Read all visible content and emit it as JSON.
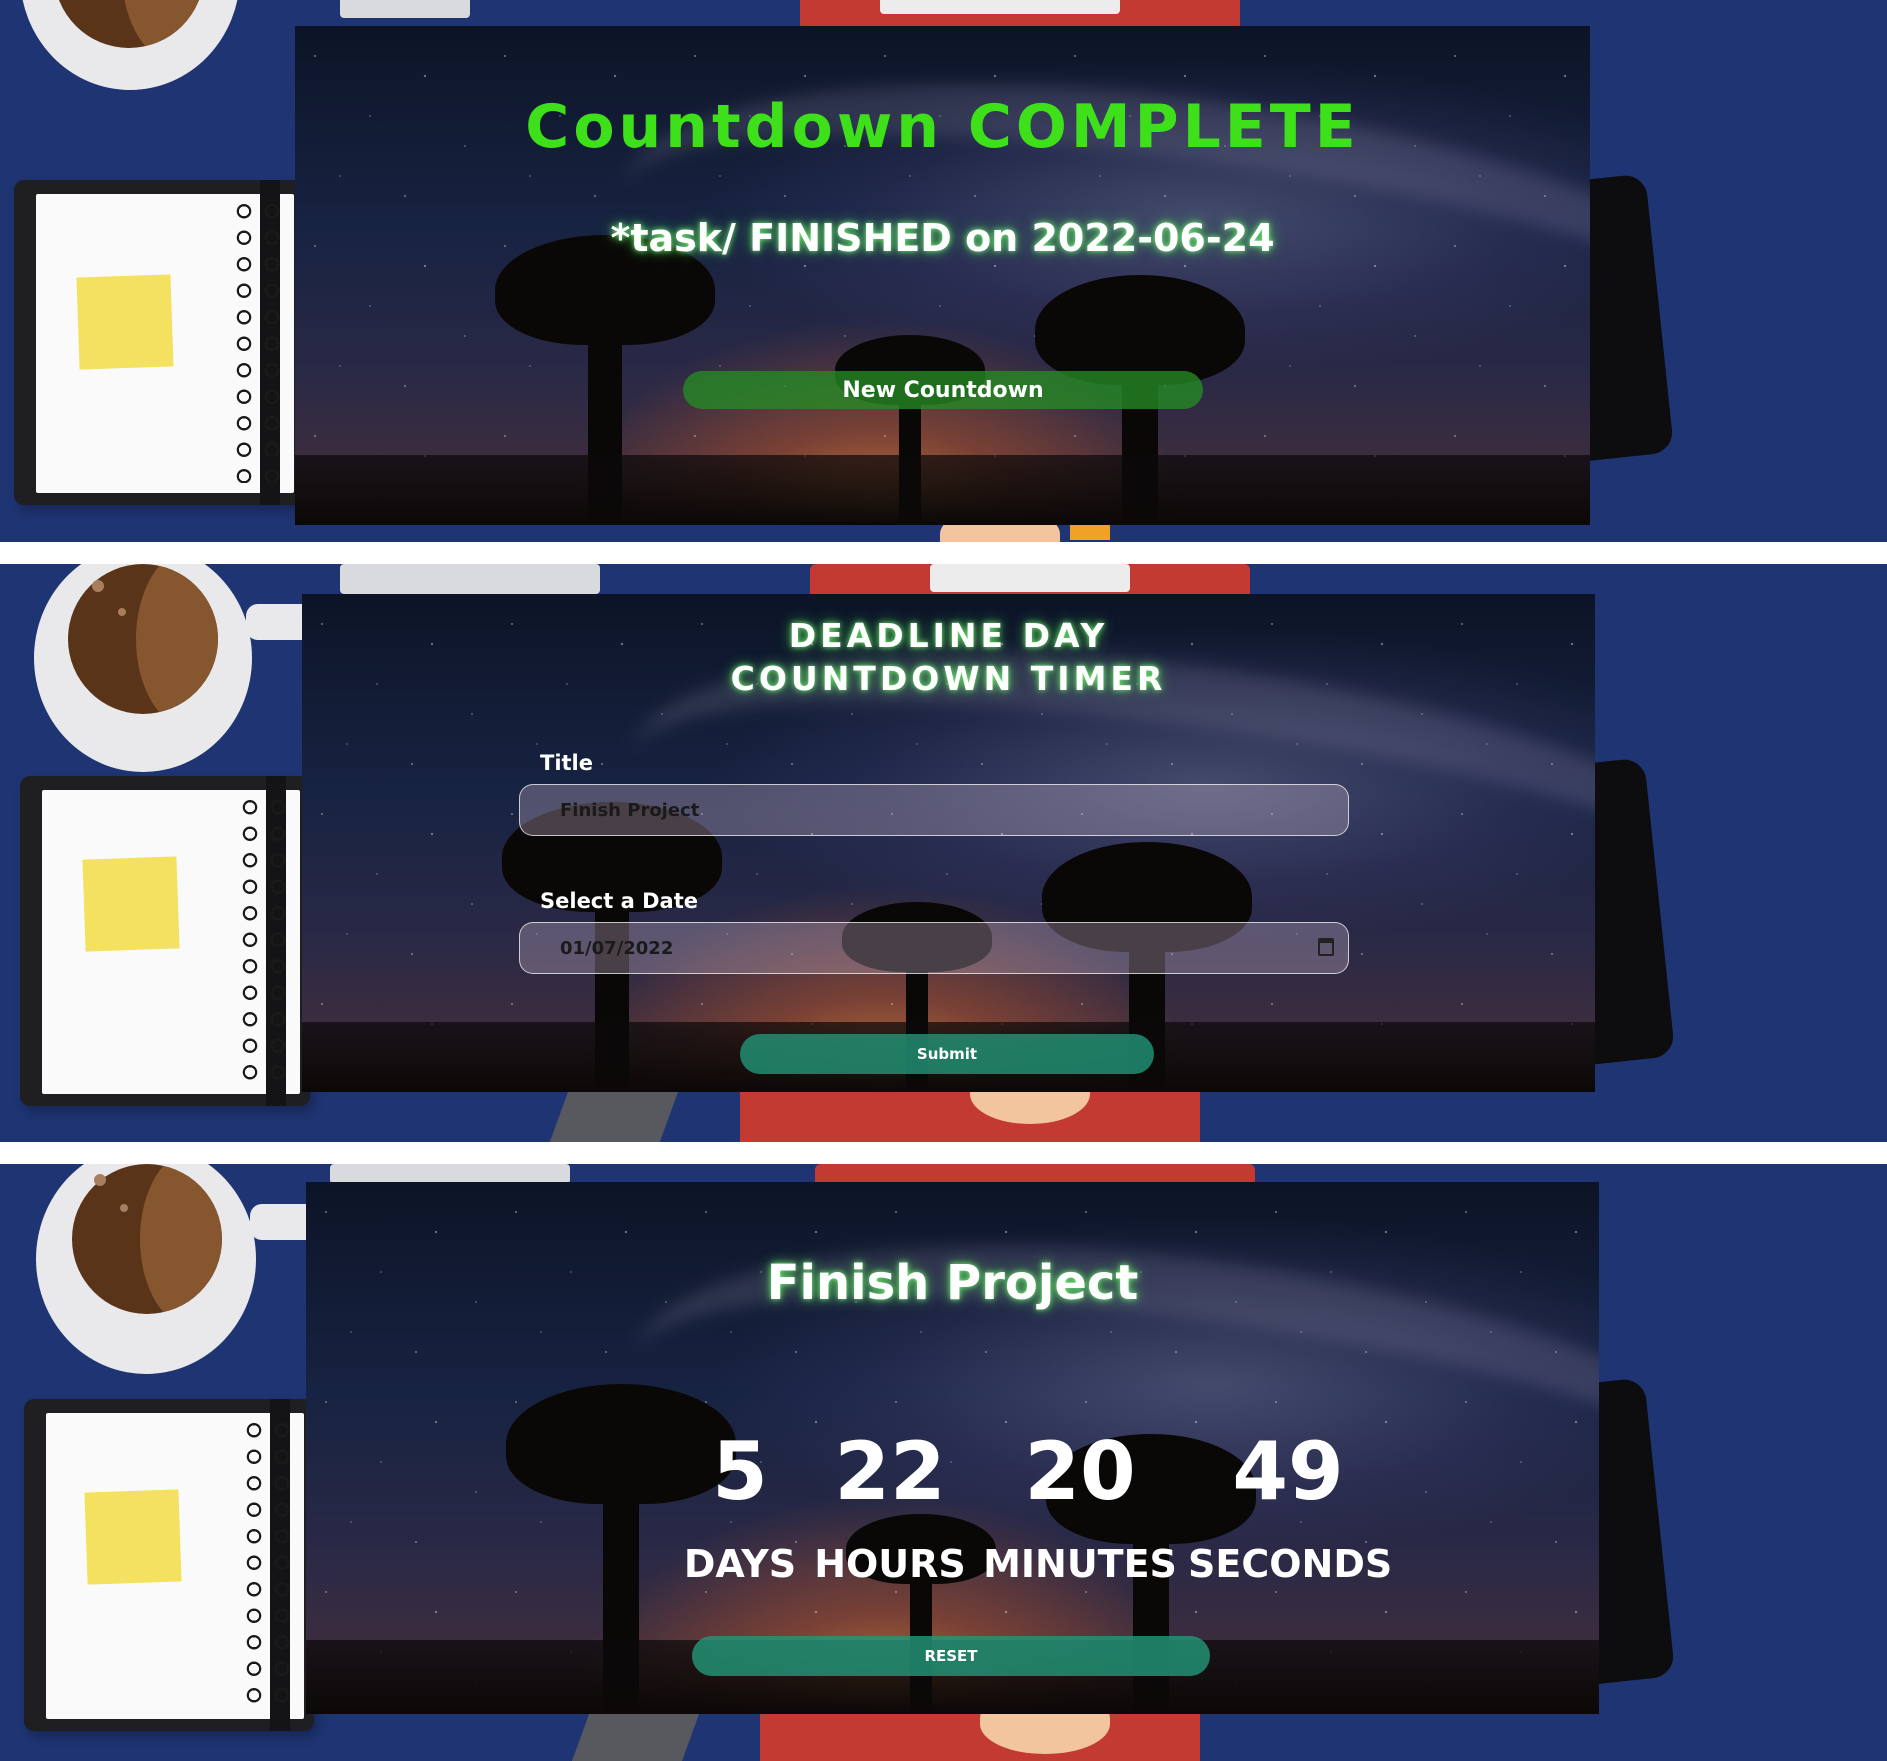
{
  "complete_view": {
    "heading": "Countdown COMPLETE",
    "finished_message": "*task/ FINISHED on 2022-06-24",
    "new_countdown_label": "New Countdown",
    "heading_color": "#3ee01a"
  },
  "form_view": {
    "heading_line1": "DEADLINE DAY",
    "heading_line2": "COUNTDOWN TIMER",
    "title_label": "Title",
    "title_value": "Finish Project",
    "date_label": "Select a Date",
    "date_value": "01/07/2022",
    "date_icon": "calendar-icon",
    "submit_label": "Submit"
  },
  "countdown_view": {
    "task_title": "Finish Project",
    "days": "5",
    "hours": "22",
    "minutes": "20",
    "seconds": "49",
    "days_label": "DAYS",
    "hours_label": "HOURS",
    "minutes_label": "MINUTES",
    "seconds_label": "SECONDS",
    "reset_label": "RESET"
  },
  "colors": {
    "desk_background": "#1f3473",
    "button_green": "#248c24",
    "button_teal": "#229678"
  }
}
